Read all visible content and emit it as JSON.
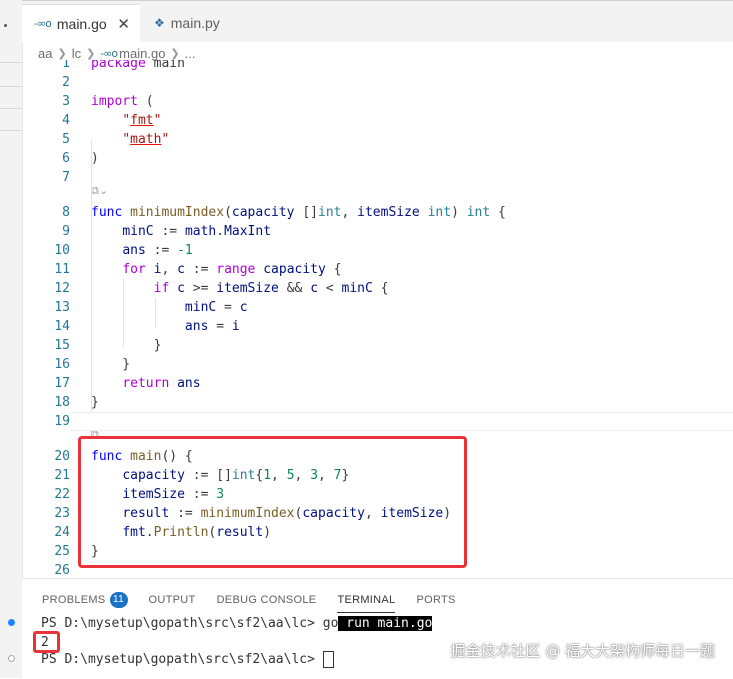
{
  "tabs": [
    {
      "label": "main.go",
      "icon": "go-file-icon",
      "active": true
    },
    {
      "label": "main.py",
      "icon": "python-file-icon",
      "active": false
    }
  ],
  "breadcrumb": [
    "aa",
    "lc",
    "main.go",
    "..."
  ],
  "editor": {
    "lines": [
      {
        "n": "1",
        "html": "<span class=\"kw2\">package</span> main"
      },
      {
        "n": "2",
        "html": ""
      },
      {
        "n": "3",
        "html": "<span class=\"kw2\">import</span> ("
      },
      {
        "n": "4",
        "html": "    <span class=\"str\">\"<span class=\"str-u\">fmt</span>\"</span>"
      },
      {
        "n": "5",
        "html": "    <span class=\"str\">\"<span class=\"str-u\">math</span>\"</span>"
      },
      {
        "n": "6",
        "html": ")"
      },
      {
        "n": "7",
        "html": ""
      },
      {
        "n": "8",
        "html": "<span class=\"kw\">func</span> <span class=\"fn\">minimumIndex</span>(<span class=\"var\">capacity</span> []<span class=\"ty\">int</span>, <span class=\"var\">itemSize</span> <span class=\"ty\">int</span>) <span class=\"ty\">int</span> {"
      },
      {
        "n": "9",
        "html": "    <span class=\"var\">minC</span> := <span class=\"pkg\">math</span>.<span class=\"var\">MaxInt</span>"
      },
      {
        "n": "10",
        "html": "    <span class=\"var\">ans</span> := <span class=\"num\">-1</span>"
      },
      {
        "n": "11",
        "html": "    <span class=\"kw2\">for</span> <span class=\"var\">i</span>, <span class=\"var\">c</span> := <span class=\"kw2\">range</span> <span class=\"var\">capacity</span> {"
      },
      {
        "n": "12",
        "html": "        <span class=\"kw2\">if</span> <span class=\"var\">c</span> >= <span class=\"var\">itemSize</span> && <span class=\"var\">c</span> < <span class=\"var\">minC</span> {"
      },
      {
        "n": "13",
        "html": "            <span class=\"var\">minC</span> = <span class=\"var\">c</span>"
      },
      {
        "n": "14",
        "html": "            <span class=\"var\">ans</span> = <span class=\"var\">i</span>"
      },
      {
        "n": "15",
        "html": "        }"
      },
      {
        "n": "16",
        "html": "    }"
      },
      {
        "n": "17",
        "html": "    <span class=\"kw2\">return</span> <span class=\"var\">ans</span>"
      },
      {
        "n": "18",
        "html": "}"
      },
      {
        "n": "19",
        "html": ""
      },
      {
        "n": "20",
        "html": "<span class=\"kw\">func</span> <span class=\"fn\">main</span>() {"
      },
      {
        "n": "21",
        "html": "    <span class=\"var\">capacity</span> := []<span class=\"ty\">int</span>{<span class=\"num\">1</span>, <span class=\"num\">5</span>, <span class=\"num\">3</span>, <span class=\"num\">7</span>}"
      },
      {
        "n": "22",
        "html": "    <span class=\"var\">itemSize</span> := <span class=\"num\">3</span>"
      },
      {
        "n": "23",
        "html": "    <span class=\"var\">result</span> := <span class=\"fn\">minimumIndex</span>(<span class=\"var\">capacity</span>, <span class=\"var\">itemSize</span>)"
      },
      {
        "n": "24",
        "html": "    <span class=\"pkg\">fmt</span>.<span class=\"fn\">Println</span>(<span class=\"var\">result</span>)"
      },
      {
        "n": "25",
        "html": "}"
      },
      {
        "n": "26",
        "html": ""
      }
    ]
  },
  "panel": {
    "tabs": [
      {
        "label": "PROBLEMS",
        "badge": "11"
      },
      {
        "label": "OUTPUT"
      },
      {
        "label": "DEBUG CONSOLE"
      },
      {
        "label": "TERMINAL",
        "active": true
      },
      {
        "label": "PORTS"
      }
    ],
    "terminal": {
      "prompt1": "PS D:\\mysetup\\gopath\\src\\sf2\\aa\\lc> ",
      "cmd_go": "go",
      "cmd_rest": " run main.go",
      "output": "2",
      "prompt2": "PS D:\\mysetup\\gopath\\src\\sf2\\aa\\lc> "
    }
  },
  "watermark": "掘金技术社区 @ 福大大架构师每日一题",
  "colors": {
    "highlight_box": "#e8333a",
    "badge": "#1a73c6"
  }
}
